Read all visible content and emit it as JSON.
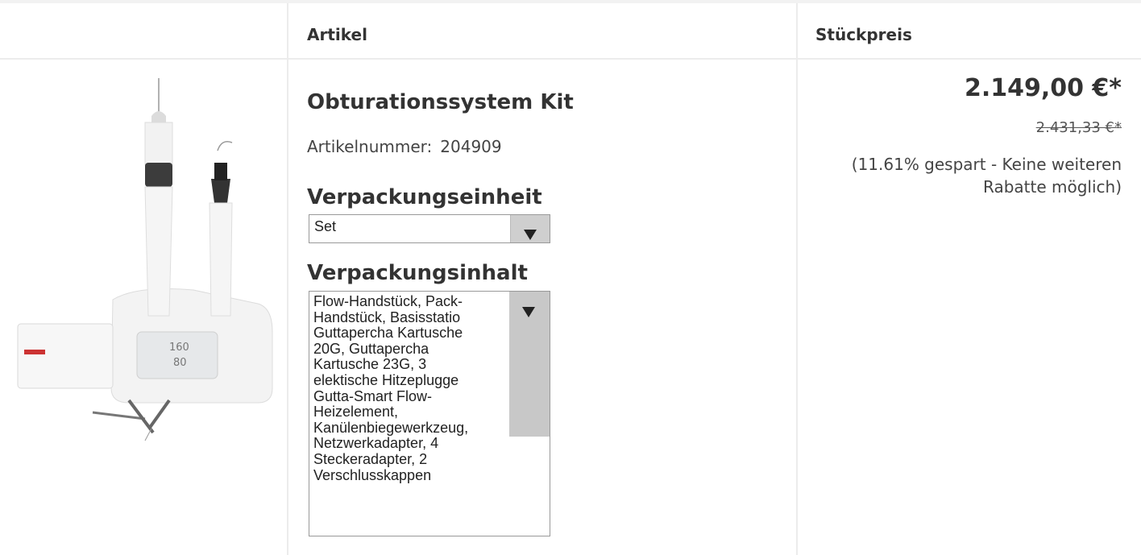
{
  "table": {
    "headers": {
      "article": "Artikel",
      "unit_price": "Stückpreis"
    }
  },
  "product": {
    "image_icon": "dental-obturation-system-image",
    "title": "Obturationssystem Kit",
    "article_number_label": "Artikelnummer:",
    "article_number": "204909",
    "packaging_unit": {
      "heading": "Verpackungseinheit",
      "selected": "Set"
    },
    "packaging_content": {
      "heading": "Verpackungsinhalt",
      "text": "Flow-Handstück, Pack-\nHandstück, Basisstatio\nGuttapercha Kartusche\n20G, Guttapercha\nKartusche 23G, 3\nelektische Hitzeplugge\nGutta-Smart Flow-\nHeizelement,\nKanülenbiegewerkzeug,\nNetzwerkadapter, 4\nSteckeradapter, 2\nVerschlusskappen"
    }
  },
  "pricing": {
    "price": "2.149,00 €*",
    "old_price": "2.431,33 €*",
    "savings_note": "(11.61% gespart - Keine weiteren Rabatte möglich)"
  },
  "colors": {
    "border": "#ececec",
    "text": "#333333",
    "select_button": "#cfcfcf"
  }
}
